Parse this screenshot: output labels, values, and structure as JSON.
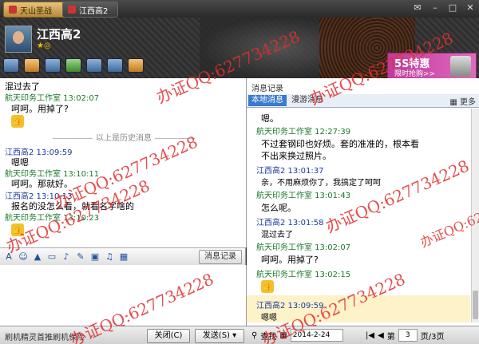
{
  "titlebar": {
    "tab1": "天山圣战",
    "tab2": "江西高2"
  },
  "header": {
    "contact_name": "江西高2",
    "ad_title": "5S特惠",
    "ad_sub": "限时抢购>>"
  },
  "left_messages": [
    {
      "kind": "c",
      "text": "混过去了"
    },
    {
      "kind": "s",
      "text": "航天印务工作室  13:02:07"
    },
    {
      "kind": "c",
      "text": "呵呵。用掉了?"
    },
    {
      "kind": "h",
      "text": "以上是历史消息"
    },
    {
      "kind": "m",
      "text": "江西高2  13:09:59"
    },
    {
      "kind": "c",
      "text": "嗯嗯"
    },
    {
      "kind": "s",
      "text": "航天印务工作室  13:10:11"
    },
    {
      "kind": "c",
      "text": "呵呵。那就好。"
    },
    {
      "kind": "m",
      "text": "江西高2  13:10:13"
    },
    {
      "kind": "c",
      "text": "报名的没怎么看，就看名字啥的"
    },
    {
      "kind": "s",
      "text": "航天印务工作室  13:10:23"
    }
  ],
  "left_tools": {
    "history_button": "消息记录"
  },
  "footer": {
    "status": "刷机精灵首推刷机保险",
    "close_label": "关闭(C)",
    "send_label": "发送(S)",
    "search_label": "查找",
    "date": "2014-2-24",
    "page_prefix": "第",
    "page_current": "3",
    "page_total": "页/3页"
  },
  "right": {
    "title": "消息记录",
    "tab_local": "本地消息",
    "tab_roam": "漫游消息",
    "more": "更多",
    "messages": [
      {
        "kind": "c",
        "text": "嗯。"
      },
      {
        "kind": "s",
        "text": "航天印务工作室 12:27:39"
      },
      {
        "kind": "c",
        "text": "不过套钢印也好烦。套的准准的，根本看"
      },
      {
        "kind": "c",
        "text": "不出来换过照片。"
      },
      {
        "kind": "m",
        "text": "江西高2 13:01:37"
      },
      {
        "kind": "c",
        "text": "亲，不用麻烦你了，我搞定了呵呵"
      },
      {
        "kind": "s",
        "text": "航天印务工作室 13:01:43"
      },
      {
        "kind": "c",
        "text": "怎么呢。"
      },
      {
        "kind": "m",
        "text": "江西高2 13:01:58"
      },
      {
        "kind": "c",
        "text": "混过去了"
      },
      {
        "kind": "s",
        "text": "航天印务工作室 13:02:07"
      },
      {
        "kind": "c",
        "text": "呵呵。用掉了?"
      },
      {
        "kind": "s",
        "text": "航天印务工作室 13:02:15"
      },
      {
        "kind": "m",
        "text": "江西高2 13:09:59"
      },
      {
        "kind": "c",
        "text": "嗯嗯"
      }
    ]
  },
  "watermark": "办证QQ:627734228"
}
